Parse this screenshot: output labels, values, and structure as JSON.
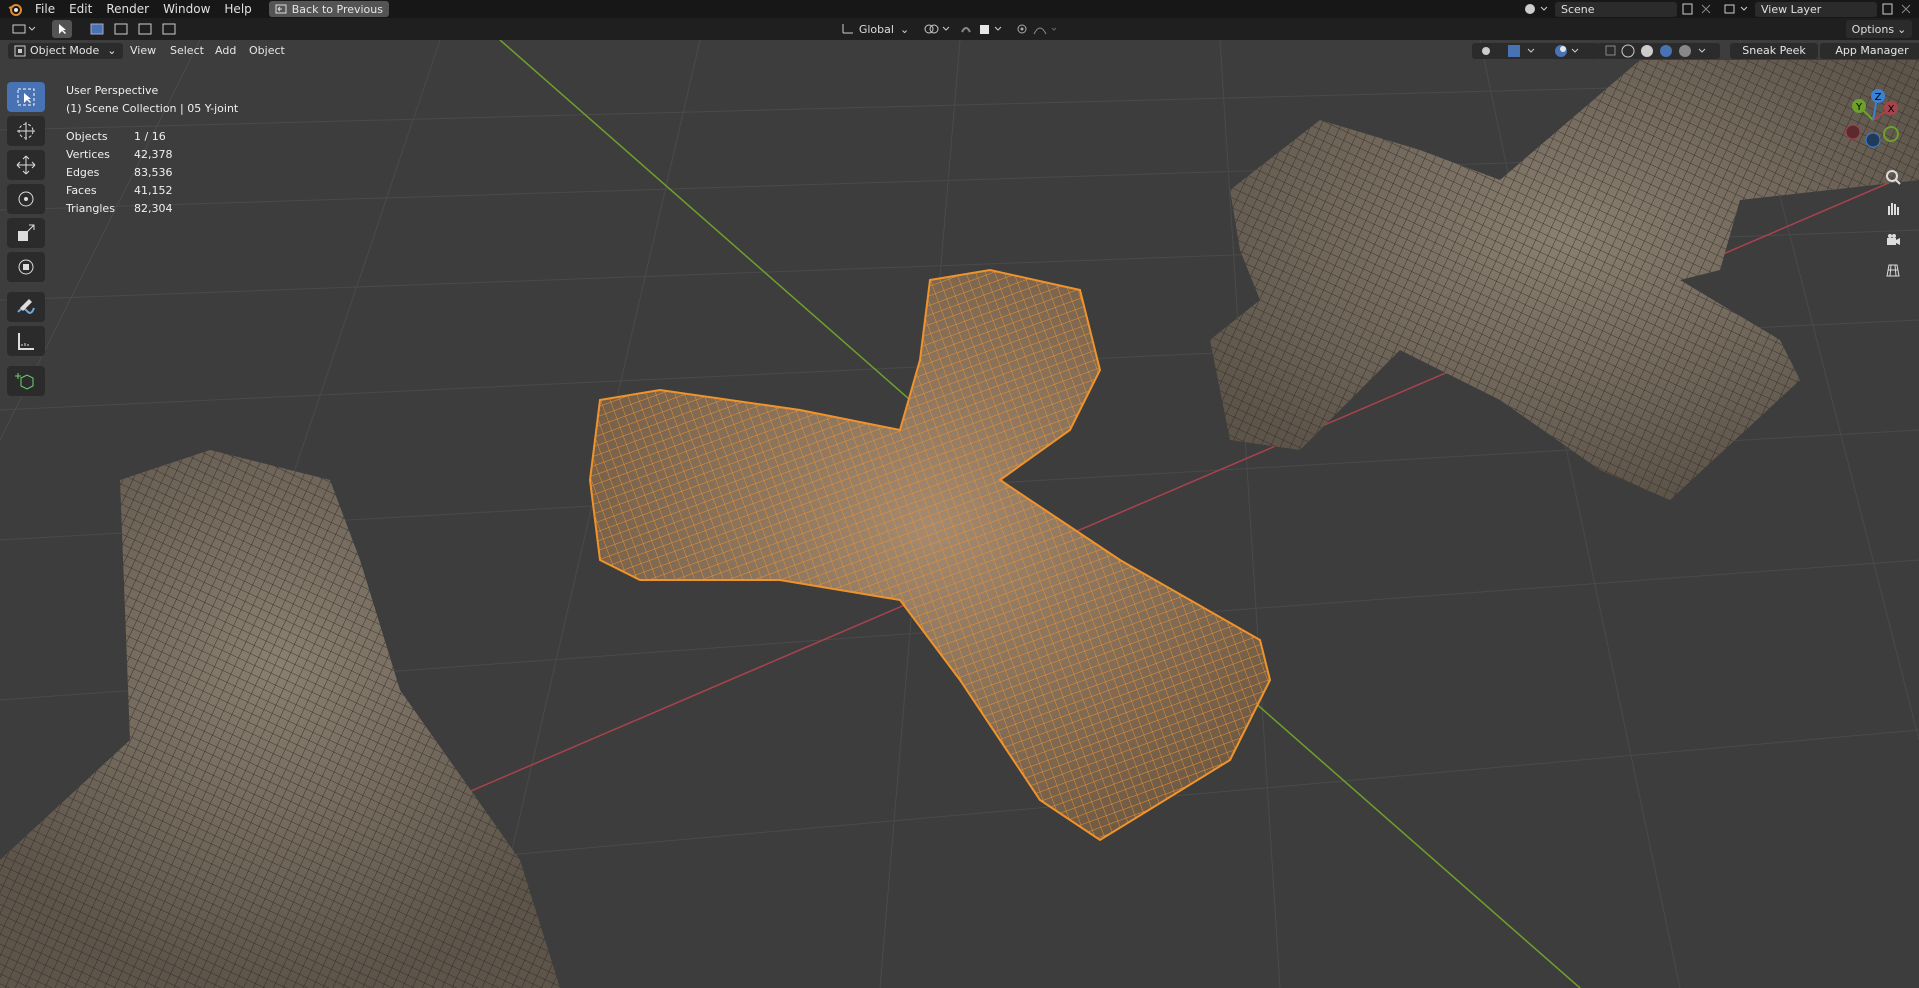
{
  "menu": {
    "items": [
      "File",
      "Edit",
      "Render",
      "Window",
      "Help"
    ],
    "back_label": "Back to Previous"
  },
  "scene": {
    "scene_name": "Scene",
    "view_layer": "View Layer"
  },
  "header": {
    "transform_orientation": "Global",
    "options_label": "Options"
  },
  "viewport_header": {
    "mode": "Object Mode",
    "menus": [
      "View",
      "Select",
      "Add",
      "Object"
    ],
    "sneak_peek": "Sneak Peek",
    "app_manager": "App Manager"
  },
  "overlay": {
    "perspective": "User Perspective",
    "collection": "(1) Scene Collection | 05 Y-joint",
    "stats": [
      {
        "label": "Objects",
        "value": "1 / 16"
      },
      {
        "label": "Vertices",
        "value": "42,378"
      },
      {
        "label": "Edges",
        "value": "83,536"
      },
      {
        "label": "Faces",
        "value": "41,152"
      },
      {
        "label": "Triangles",
        "value": "82,304"
      }
    ]
  },
  "gizmo": {
    "x_label": "X",
    "y_label": "Y",
    "z_label": "Z"
  },
  "colors": {
    "selection": "#f0932b",
    "x_axis": "#a8434c",
    "y_axis": "#6ea12b",
    "z_axis": "#3b82d6",
    "accent": "#4772b3"
  },
  "tools": [
    "select-box-icon",
    "cursor-icon",
    "move-icon",
    "rotate-icon",
    "scale-icon",
    "transform-icon",
    "annotate-icon",
    "measure-icon",
    "add-cube-icon"
  ]
}
